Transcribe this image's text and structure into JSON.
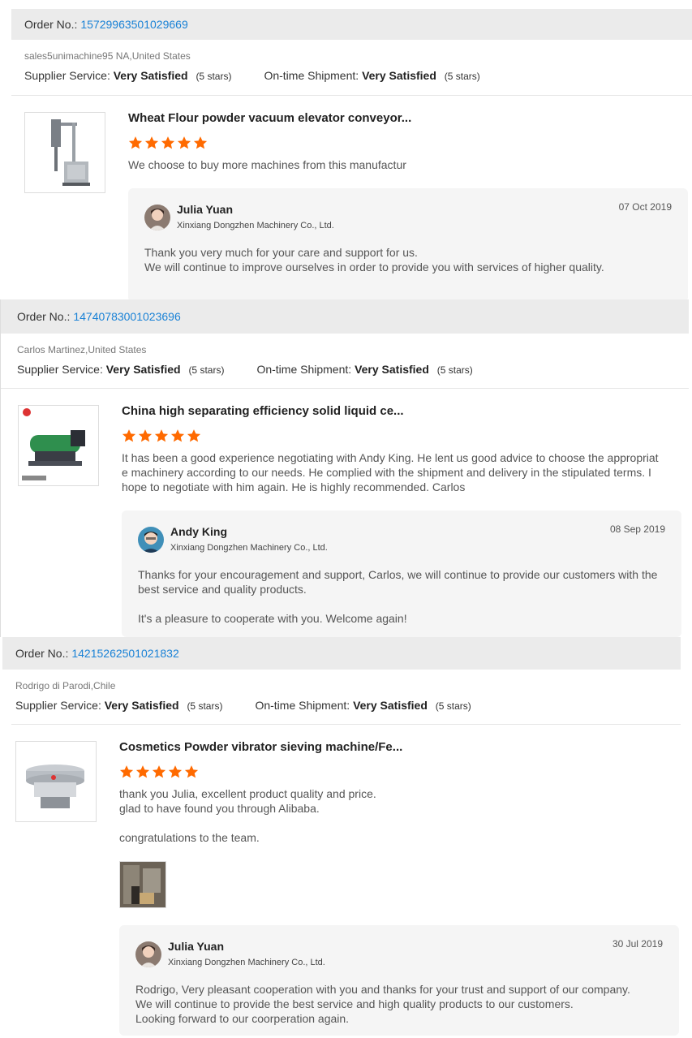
{
  "order_label": "Order No.:",
  "supplier_label": "Supplier Service:",
  "shipment_label": "On-time Shipment:",
  "colors": {
    "accent_link": "#1a82d6",
    "star": "#ff6a00",
    "bar_bg": "#ebebeb",
    "reply_bg": "#f5f5f5"
  },
  "orders": [
    {
      "number": "15729963501029669",
      "buyer": "sales5unimachine95 NA,United States",
      "supplier_rating": "Very Satisfied",
      "supplier_stars": "(5 stars)",
      "shipment_rating": "Very Satisfied",
      "shipment_stars": "(5 stars)",
      "product_title": "Wheat Flour powder vacuum elevator conveyor...",
      "star_rating": 5,
      "review": "We choose to buy more machines from this manufactur",
      "reply": {
        "name": "Julia Yuan",
        "company": "Xinxiang Dongzhen Machinery Co., Ltd.",
        "date": "07 Oct 2019",
        "text": "Thank you very much for your care and support for us.\nWe will continue to improve ourselves in order to provide you with services of higher quality."
      }
    },
    {
      "number": "14740783001023696",
      "buyer": "Carlos Martinez,United States",
      "supplier_rating": "Very Satisfied",
      "supplier_stars": "(5 stars)",
      "shipment_rating": "Very Satisfied",
      "shipment_stars": "(5 stars)",
      "product_title": "China high separating efficiency solid liquid ce...",
      "star_rating": 5,
      "review": "It has been a good experience negotiating with Andy King. He lent us good advice to choose the appropriat\ne machinery according to our needs. He complied with the shipment and delivery in the stipulated terms. I\nhope to negotiate with him again. He is highly recommended. Carlos",
      "reply": {
        "name": "Andy King",
        "company": "Xinxiang Dongzhen Machinery Co., Ltd.",
        "date": "08 Sep 2019",
        "text": "Thanks for your encouragement and support, Carlos, we will continue to provide our customers with the\nbest service and quality products.\n\nIt's a pleasure to cooperate with you. Welcome again!"
      }
    },
    {
      "number": "14215262501021832",
      "buyer": "Rodrigo di Parodi,Chile",
      "supplier_rating": "Very Satisfied",
      "supplier_stars": "(5 stars)",
      "shipment_rating": "Very Satisfied",
      "shipment_stars": "(5 stars)",
      "product_title": "Cosmetics Powder vibrator sieving machine/Fe...",
      "star_rating": 5,
      "review": "thank you Julia, excellent product quality and price.\nglad to have found you through Alibaba.\n\ncongratulations to the team.",
      "reply": {
        "name": "Julia Yuan",
        "company": "Xinxiang Dongzhen Machinery Co., Ltd.",
        "date": "30 Jul 2019",
        "text": "Rodrigo, Very pleasant cooperation with you and thanks for your trust and support of our company.\nWe will continue to provide the best service and high quality products to our customers.\nLooking forward to our coorperation again."
      }
    }
  ]
}
